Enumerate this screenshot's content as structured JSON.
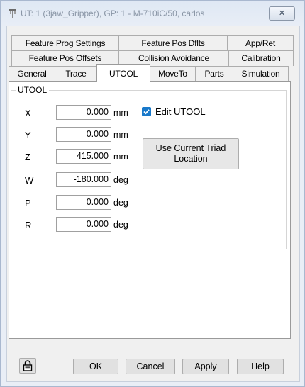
{
  "window": {
    "title": "UT: 1  (3jaw_Gripper), GP: 1 - M-710iC/50, carlos",
    "close_label": "✕"
  },
  "tabs": {
    "row1": [
      {
        "label": "Feature Prog Settings"
      },
      {
        "label": "Feature Pos Dflts"
      },
      {
        "label": "App/Ret"
      }
    ],
    "row2": [
      {
        "label": "Feature Pos Offsets"
      },
      {
        "label": "Collision Avoidance"
      },
      {
        "label": "Calibration"
      }
    ],
    "row3": [
      {
        "label": "General"
      },
      {
        "label": "Trace"
      },
      {
        "label": "UTOOL",
        "active": true
      },
      {
        "label": "MoveTo"
      },
      {
        "label": "Parts"
      },
      {
        "label": "Simulation"
      }
    ]
  },
  "utool": {
    "group_label": "UTOOL",
    "fields": [
      {
        "label": "X",
        "value": "0.000",
        "unit": "mm"
      },
      {
        "label": "Y",
        "value": "0.000",
        "unit": "mm"
      },
      {
        "label": "Z",
        "value": "415.000",
        "unit": "mm"
      },
      {
        "label": "W",
        "value": "-180.000",
        "unit": "deg"
      },
      {
        "label": "P",
        "value": "0.000",
        "unit": "deg"
      },
      {
        "label": "R",
        "value": "0.000",
        "unit": "deg"
      }
    ],
    "edit_checkbox": {
      "label": "Edit UTOOL",
      "checked": true
    },
    "triad_button": {
      "line1": "Use Current Triad",
      "line2": "Location"
    }
  },
  "buttons": {
    "ok": "OK",
    "cancel": "Cancel",
    "apply": "Apply",
    "help": "Help"
  }
}
